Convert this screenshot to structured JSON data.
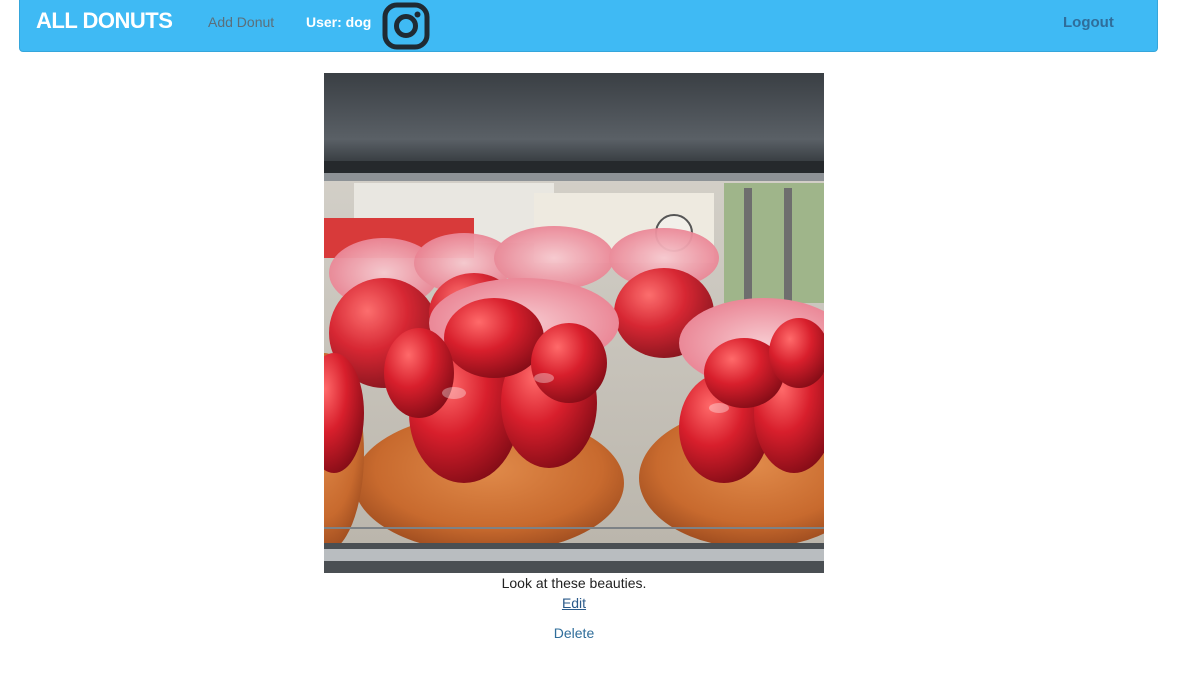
{
  "navbar": {
    "brand": "ALL DONUTS",
    "add_donut": "Add Donut",
    "user_label": "User: dog",
    "instagram_icon": "instagram-icon",
    "logout": "Logout",
    "bg_color": "#3fbaf4"
  },
  "post": {
    "caption": "Look at these beauties.",
    "edit_label": "Edit",
    "delete_label": "Delete"
  }
}
